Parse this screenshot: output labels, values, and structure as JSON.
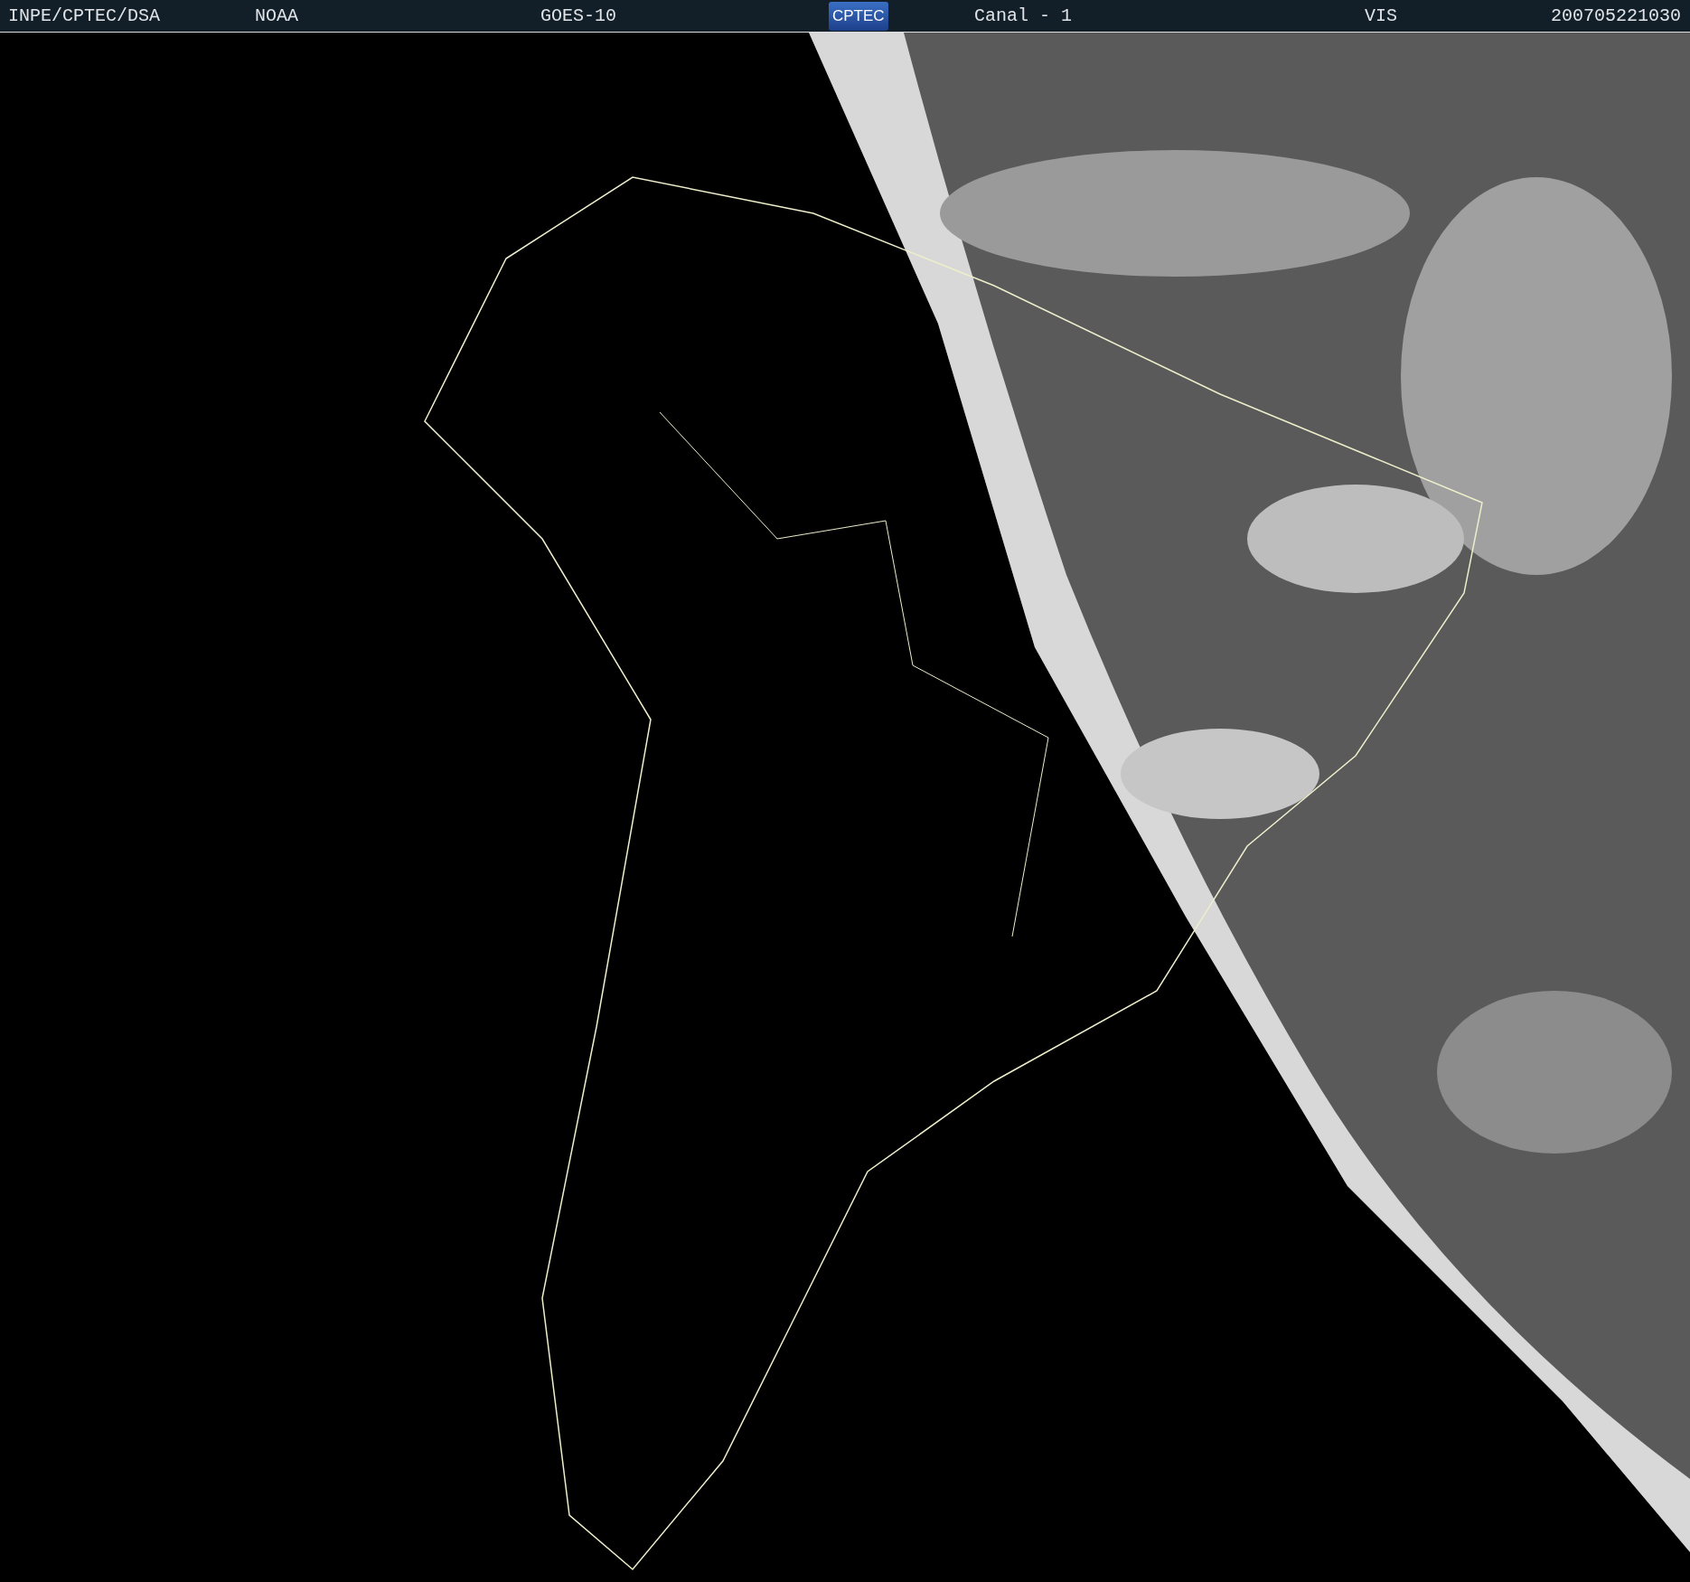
{
  "header": {
    "items": [
      {
        "kind": "label",
        "text": "INPE/CPTEC/DSA"
      },
      {
        "kind": "label",
        "text": "NOAA"
      },
      {
        "kind": "label",
        "text": "GOES-10"
      },
      {
        "kind": "logo",
        "text": "CPTEC"
      },
      {
        "kind": "label",
        "text": "Canal - 1"
      },
      {
        "kind": "label",
        "text": "VIS"
      },
      {
        "kind": "label",
        "text": "200705221030"
      }
    ]
  }
}
